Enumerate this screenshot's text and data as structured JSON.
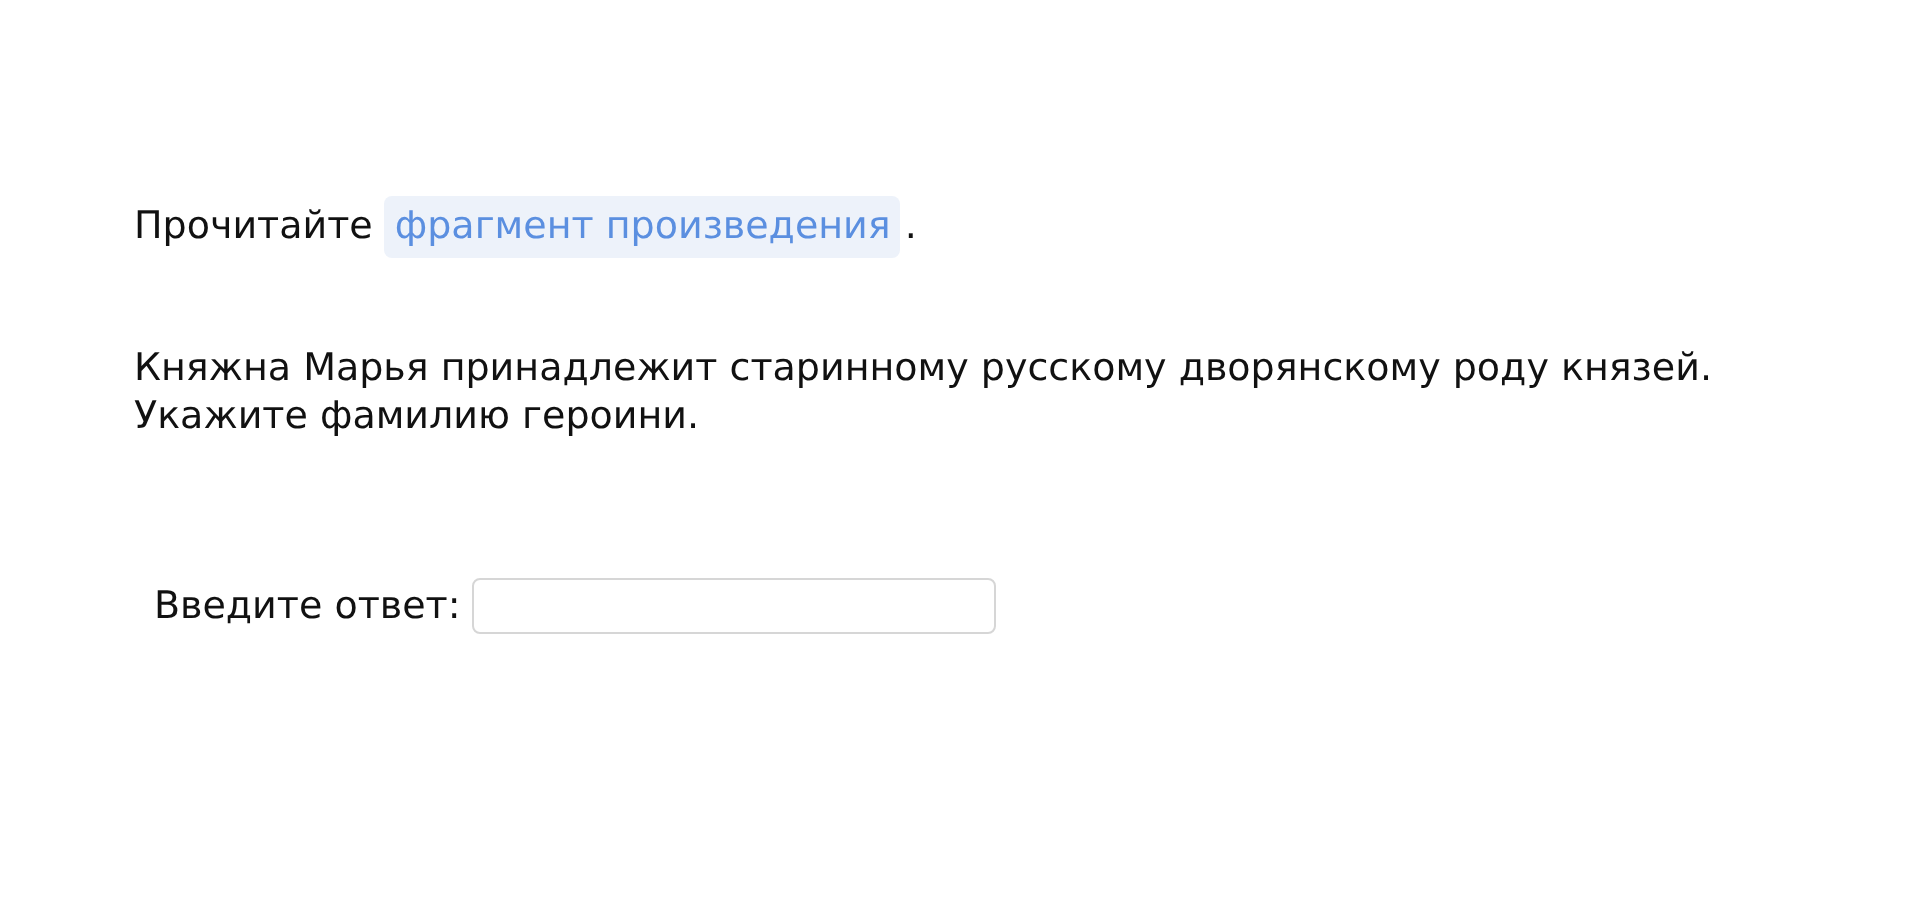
{
  "intro": {
    "text": "Прочитайте",
    "link": "фрагмент произведения",
    "end": "."
  },
  "question": [
    "Княжна Марья принадлежит старинному русскому дворянскому роду князей.",
    "Укажите фамилию героини."
  ],
  "answer": {
    "label": "Введите ответ:"
  }
}
